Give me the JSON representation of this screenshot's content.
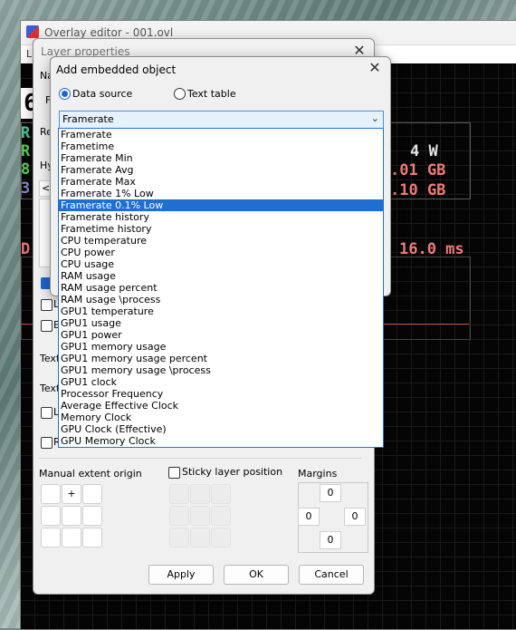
{
  "main_window": {
    "title": "Overlay editor - 001.ovl",
    "menu_hint": "L"
  },
  "osd": {
    "lines": [
      {
        "text": "R",
        "color": "#4cc9a0"
      },
      {
        "text": "R",
        "color": "#5bd15b"
      },
      {
        "text": "8",
        "color": "#5bd15b"
      },
      {
        "text": "3",
        "color": "#8a8ad8"
      }
    ],
    "values": [
      {
        "text": "4 W",
        "color": "#e6e6e6"
      },
      {
        "text": ".01 GB",
        "color": "#f07a7a"
      },
      {
        "text": ".10 GB",
        "color": "#f07a7a"
      }
    ],
    "frametime_label": "D",
    "frametime_value": "16.0 ms",
    "frametime_color": "#f07a7a"
  },
  "layer_properties": {
    "title": "Layer properties",
    "name_label": "Na",
    "field_label": "F",
    "re_label": "Re",
    "hy_label": "Hy",
    "arrow_label": "<",
    "checks": [
      {
        "label": "L",
        "checked": false
      },
      {
        "label": "E",
        "checked": false
      }
    ],
    "text_label_1": "Text",
    "text_label_2": "Text",
    "check_l2": "L",
    "check_r": "R",
    "manual_extent_label": "Manual extent origin",
    "center_glyph": "+",
    "sticky_label": "Sticky layer position",
    "margins_label": "Margins",
    "margins": {
      "top": "0",
      "left": "0",
      "right": "0",
      "bottom": "0"
    },
    "buttons": {
      "apply": "Apply",
      "ok": "OK",
      "cancel": "Cancel"
    }
  },
  "embed_dialog": {
    "title": "Add embedded object",
    "radio_data_source": "Data source",
    "radio_text_table": "Text table",
    "selected_source": "Framerate",
    "dropdown_items": [
      "Framerate",
      "Frametime",
      "Framerate Min",
      "Framerate Avg",
      "Framerate Max",
      "Framerate 1% Low",
      "Framerate 0.1% Low",
      "Framerate history",
      "Frametime history",
      "CPU temperature",
      "CPU power",
      "CPU usage",
      "RAM usage",
      "RAM usage percent",
      "RAM usage \\process",
      "GPU1 temperature",
      "GPU1 usage",
      "GPU1 power",
      "GPU1 memory usage",
      "GPU1 memory usage percent",
      "GPU1 memory usage \\process",
      "GPU1 clock",
      "Processor Frequency",
      "Average Effective Clock",
      "Memory Clock",
      "GPU Clock (Effective)",
      "GPU Memory Clock"
    ],
    "highlighted_index": 6
  }
}
